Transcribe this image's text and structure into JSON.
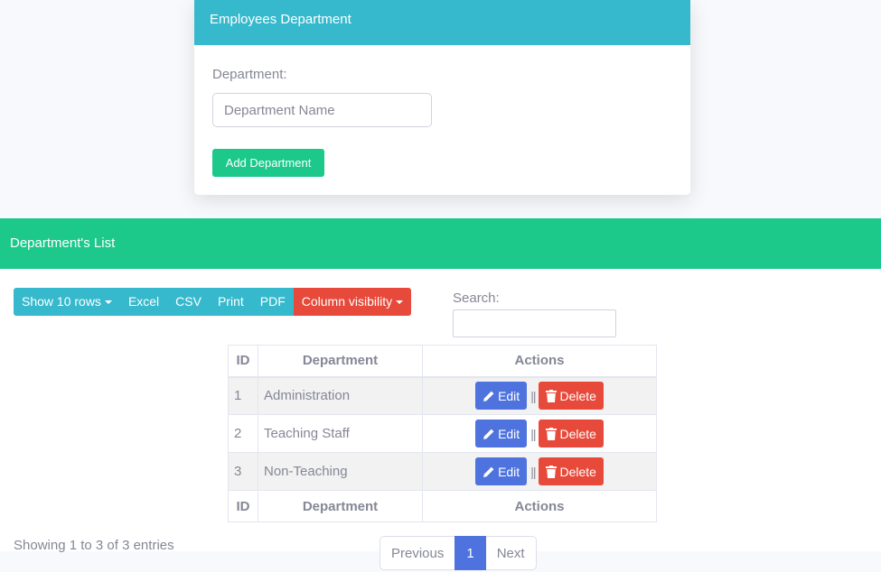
{
  "dept_form": {
    "title": "Employees Department",
    "department_label": "Department:",
    "input_value": "",
    "input_placeholder": "Department Name",
    "add_button": "Add Department"
  },
  "list": {
    "title": "Department's List",
    "toolbar": {
      "show_rows": "Show 10 rows",
      "excel": "Excel",
      "csv": "CSV",
      "print": "Print",
      "pdf": "PDF",
      "column_visibility": "Column visibility"
    },
    "search_label": "Search:",
    "search_value": "",
    "columns": [
      "ID",
      "Department",
      "Actions"
    ],
    "rows": [
      {
        "id": "1",
        "department": "Administration"
      },
      {
        "id": "2",
        "department": "Teaching Staff"
      },
      {
        "id": "3",
        "department": "Non-Teaching"
      }
    ],
    "edit_label": "Edit",
    "delete_label": "Delete",
    "separator": "||",
    "info": "Showing 1 to 3 of 3 entries",
    "pagination": {
      "previous": "Previous",
      "current": "1",
      "next": "Next"
    }
  },
  "icons": {
    "edit": "pencil-icon",
    "delete": "trash-icon",
    "dropdown": "caret-down-icon"
  },
  "colors": {
    "info": "#36b9cc",
    "success": "#1cc88a",
    "danger": "#e74a3b",
    "primary": "#4e73df"
  }
}
